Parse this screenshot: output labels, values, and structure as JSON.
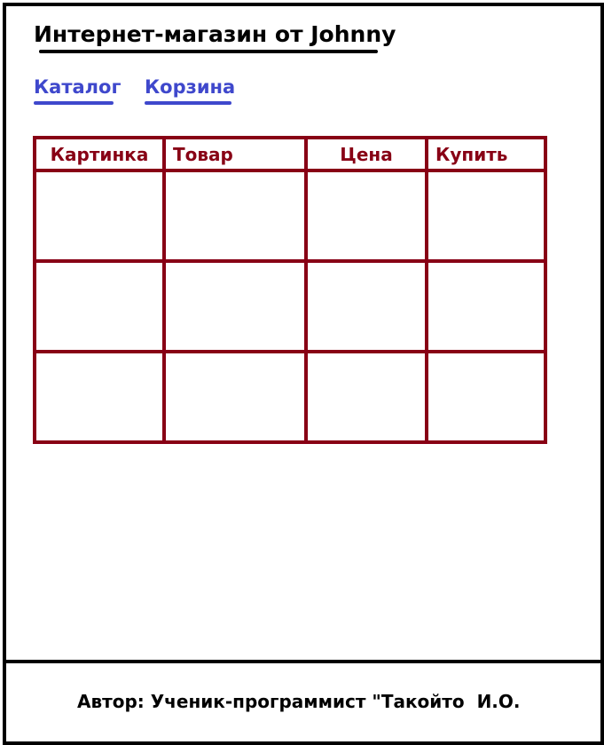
{
  "header": {
    "title": "Интернет-магазин от Johnny"
  },
  "nav": {
    "catalog_label": "Каталог",
    "cart_label": "Корзина"
  },
  "table": {
    "columns": [
      "Картинка",
      "Товар",
      "Цена",
      "Купить"
    ],
    "rows": [
      [
        "",
        "",
        "",
        ""
      ],
      [
        "",
        "",
        "",
        ""
      ],
      [
        "",
        "",
        "",
        ""
      ]
    ]
  },
  "footer": {
    "author_text": "Автор: Ученик-программист \"Такойто  И.О."
  },
  "colors": {
    "frame": "#000000",
    "nav_link": "#3f48cc",
    "table": "#880015"
  }
}
